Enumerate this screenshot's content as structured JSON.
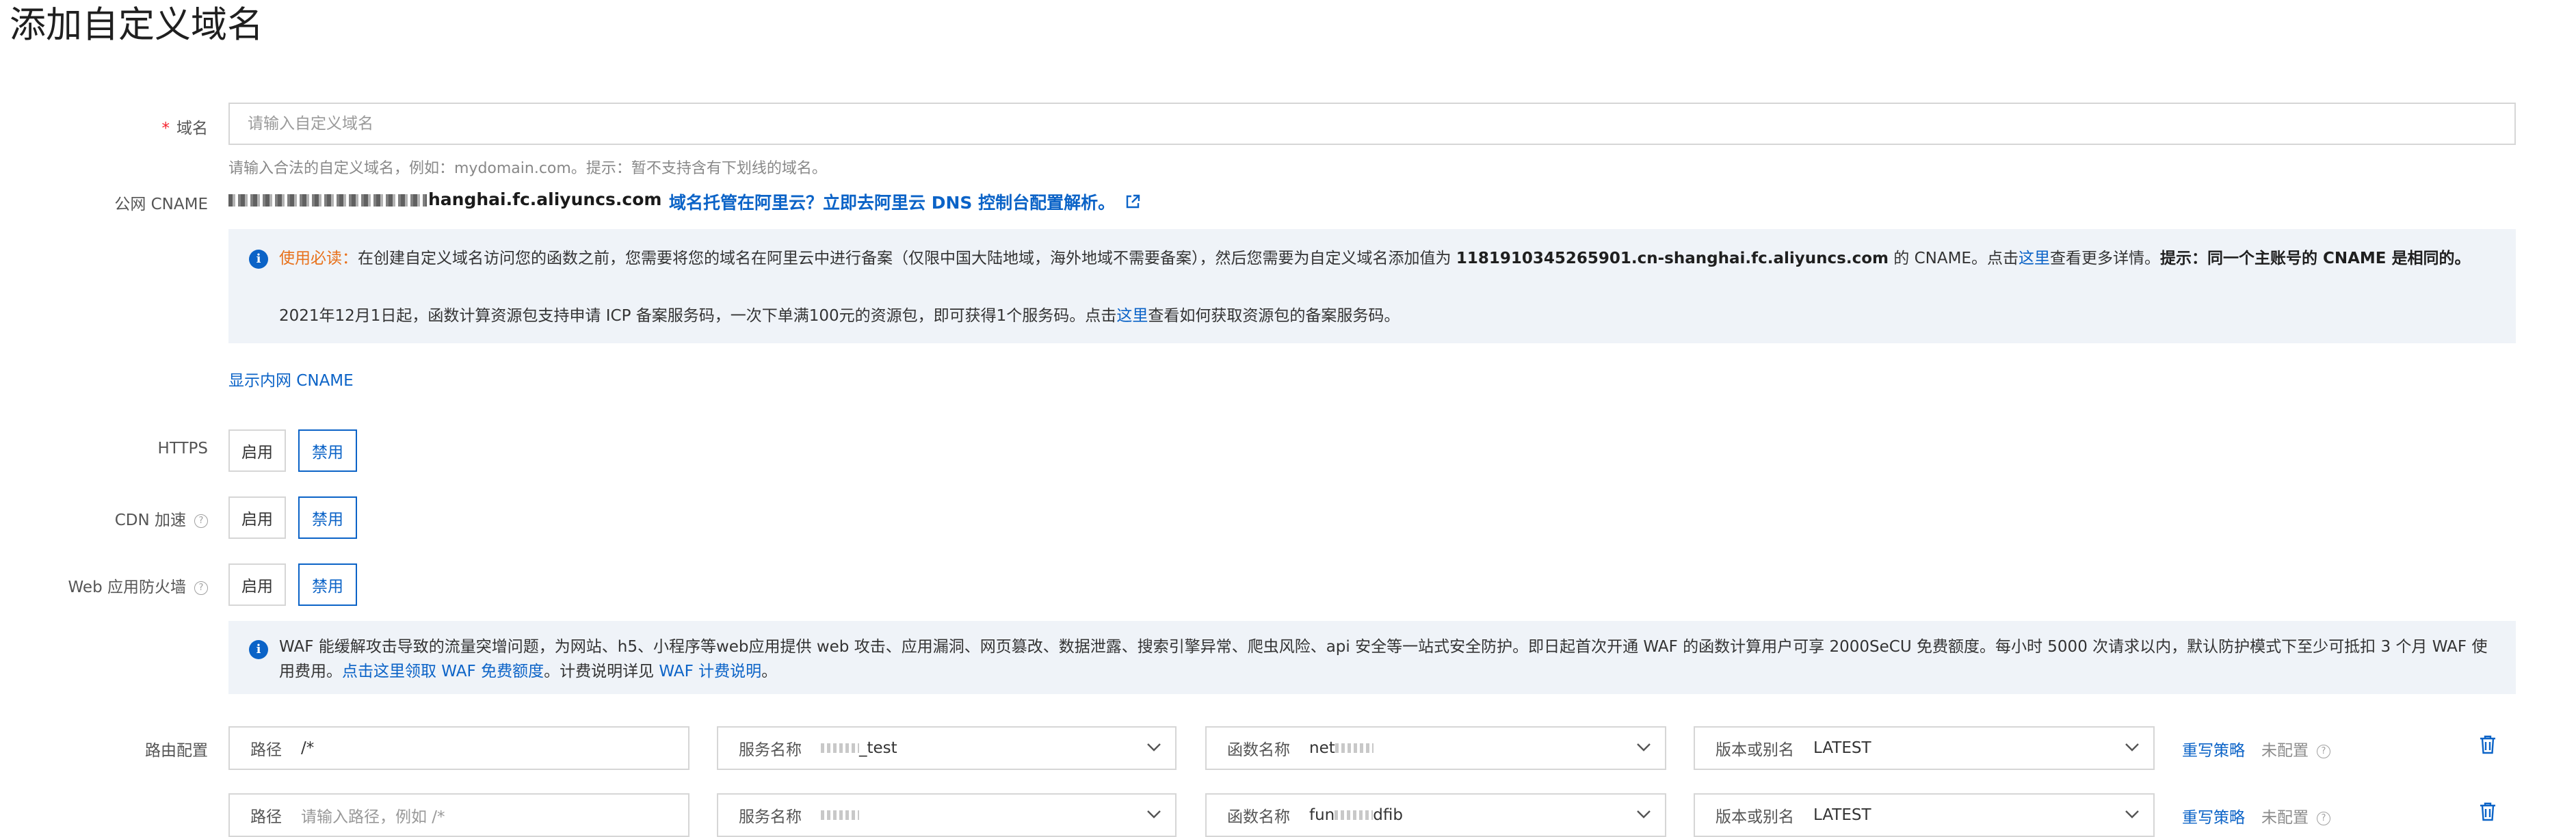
{
  "page": {
    "title": "添加自定义域名"
  },
  "domain": {
    "required_mark": "*",
    "label": "域名",
    "placeholder": "请输入自定义域名",
    "hint": "请输入合法的自定义域名，例如：mydomain.com。提示：暂不支持含有下划线的域名。"
  },
  "cname": {
    "label": "公网 CNAME",
    "value_visible": "hanghai.fc.aliyuncs.com",
    "link": "域名托管在阿里云？立即去阿里云 DNS 控制台配置解析。",
    "link_icon": "external-link-icon"
  },
  "notice": {
    "icon": "info-icon",
    "warn_prefix": "使用必读：",
    "part1": "在创建自定义域名访问您的函数之前，您需要将您的域名在阿里云中进行备案（仅限中国大陆地域，海外地域不需要备案），然后您需要为自定义域名添加值为 ",
    "cname_full": "1181910345265901.cn-shanghai.fc.aliyuncs.com",
    "part2": " 的 CNAME。点击",
    "link1": "这里",
    "part3": "查看更多详情。",
    "tip": "提示：同一个主账号的 CNAME 是相同的。",
    "line2_part1": "2021年12月1日起，函数计算资源包支持申请 ICP 备案服务码，一次下单满100元的资源包，即可获得1个服务码。点击",
    "line2_link": "这里",
    "line2_part2": "查看如何获取资源包的备案服务码。"
  },
  "show_internal_cname": "显示内网 CNAME",
  "https": {
    "label": "HTTPS",
    "enable": "启用",
    "disable": "禁用",
    "selected": "禁用"
  },
  "cdn": {
    "label": "CDN 加速",
    "help_icon": "help-circle-icon",
    "enable": "启用",
    "disable": "禁用",
    "selected": "禁用"
  },
  "waf": {
    "label": "Web 应用防火墙",
    "help_icon": "help-circle-icon",
    "enable": "启用",
    "disable": "禁用",
    "selected": "禁用",
    "notice_part1": "WAF 能缓解攻击导致的流量突增问题，为网站、h5、小程序等web应用提供 web 攻击、应用漏洞、网页篡改、数据泄露、搜索引擎异常、爬虫风险、api 安全等一站式安全防护。即日起首次开通 WAF 的函数计算用户可享 2000SeCU 免费额度。每小时 5000 次请求以内，默认防护模式下至少可抵扣 3 个月 WAF 使用费用。",
    "notice_link1": "点击这里领取 WAF 免费额度",
    "notice_part2": "。计费说明详见 ",
    "notice_link2": "WAF 计费说明",
    "notice_part3": "。"
  },
  "routes": {
    "label": "路由配置",
    "path_label": "路径",
    "service_label": "服务名称",
    "function_label": "函数名称",
    "version_label": "版本或别名",
    "rewrite_label": "重写策略",
    "rewrite_status": "未配置",
    "path_placeholder": "请输入路径，例如 /*",
    "rows": [
      {
        "path": "/*",
        "service_suffix": "_test",
        "function_prefix": "net",
        "version": "LATEST"
      },
      {
        "path": "",
        "service_suffix": "",
        "function_prefix": "fun",
        "function_suffix": "dfib",
        "version": "LATEST"
      }
    ]
  }
}
